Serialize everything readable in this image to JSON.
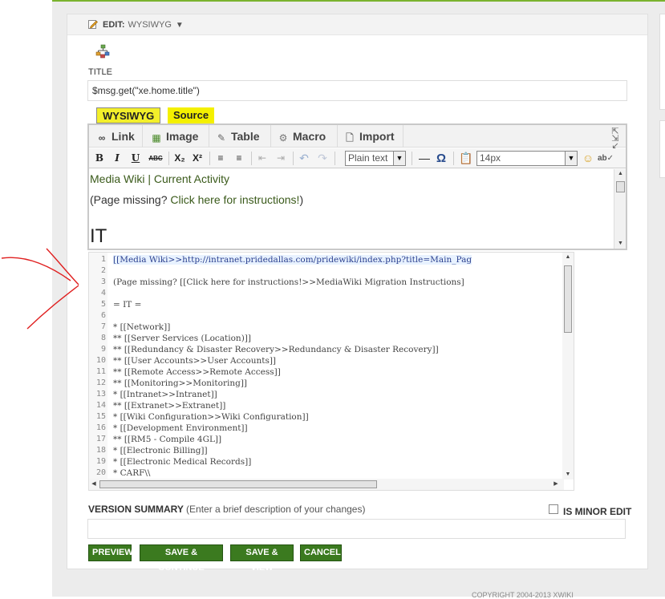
{
  "edit_header": {
    "label": "EDIT:",
    "mode": "WYSIWYG",
    "caret": "▼"
  },
  "title_label": "TITLE",
  "title_value": "$msg.get(\"xe.home.title\")",
  "mode_tabs": [
    "WYSIWYG",
    "Source"
  ],
  "toolbar_main": [
    "Link",
    "Image",
    "Table",
    "Macro",
    "Import"
  ],
  "toolbar_format": {
    "bold": "B",
    "italic": "I",
    "underline": "U",
    "strike": "ABC",
    "subscript": "X₂",
    "superscript": "X²",
    "style_select": "Plain text",
    "size_select": "14px",
    "omega": "Ω"
  },
  "content": {
    "line1": "Media Wiki | Current Activity",
    "line2_prefix": "(Page missing? ",
    "line2_link": "Click here for instructions!",
    "line2_suffix": ")",
    "heading": "IT"
  },
  "code_lines": [
    "[[Media Wiki>>http://intranet.pridedallas.com/pridewiki/index.php?title=Main_Pag",
    "",
    "(Page missing? [[Click here for instructions!>>MediaWiki Migration Instructions]",
    "",
    "= IT =",
    "",
    "* [[Network]]",
    "** [[Server Services (Location)]]",
    "** [[Redundancy & Disaster Recovery>>Redundancy & Disaster Recovery]]",
    "** [[User Accounts>>User Accounts]]",
    "** [[Remote Access>>Remote Access]]",
    "** [[Monitoring>>Monitoring]]",
    "* [[Intranet>>Intranet]]",
    "** [[Extranet>>Extranet]]",
    "* [[Wiki Configuration>>Wiki Configuration]]",
    "* [[Development Environment]]",
    "** [[RM5 - Compile 4GL]]",
    "* [[Electronic Billing]]",
    "* [[Electronic Medical Records]]",
    "* CARF\\\\"
  ],
  "version_summary": {
    "label": "VERSION SUMMARY",
    "hint": "(Enter a brief description of your changes)"
  },
  "minor_edit_label": "IS MINOR EDIT",
  "buttons": {
    "preview": "PREVIEW",
    "save_continue": "SAVE & CONTINUE",
    "save_view": "SAVE & VIEW",
    "cancel": "CANCEL"
  },
  "copyright": "COPYRIGHT 2004-2013 XWIKI",
  "colors": {
    "accent_green": "#3b7a1f",
    "highlight_yellow": "#f4f000",
    "annotation_red": "#e02020"
  }
}
